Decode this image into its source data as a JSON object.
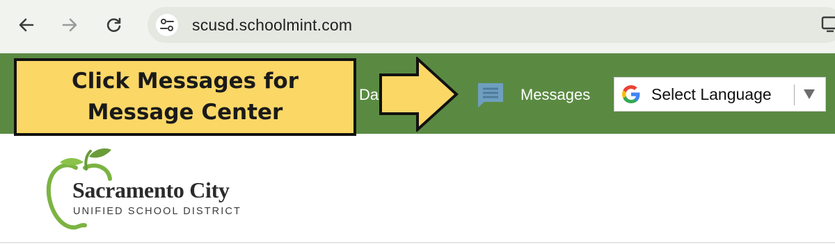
{
  "browser": {
    "url": "scusd.schoolmint.com",
    "icons": [
      "back-arrow-icon",
      "forward-arrow-icon",
      "reload-icon",
      "site-info-icon",
      "cast-icon"
    ]
  },
  "navbar": {
    "partial_item": "Da",
    "messages_label": "Messages",
    "messages_icon": "chat-bubble-icon",
    "language_select": "Select Language",
    "colors": {
      "bar": "#5a8a42",
      "message_icon": "#6f9fc0"
    }
  },
  "callout": {
    "line1": "Click Messages for",
    "line2": "Message Center",
    "colors": {
      "fill": "#fbd766",
      "border": "#111111"
    }
  },
  "logo": {
    "name": "Sacramento City",
    "subtitle": "UNIFIED SCHOOL DISTRICT",
    "colors": {
      "apple": "#7cb342"
    }
  }
}
